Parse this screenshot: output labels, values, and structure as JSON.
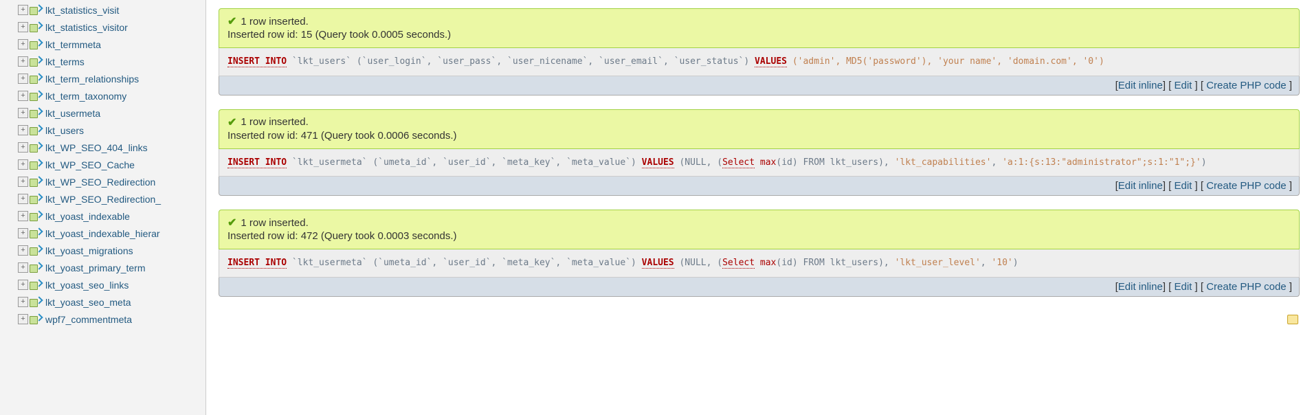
{
  "sidebar": {
    "tables": [
      "lkt_statistics_visit",
      "lkt_statistics_visitor",
      "lkt_termmeta",
      "lkt_terms",
      "lkt_term_relationships",
      "lkt_term_taxonomy",
      "lkt_usermeta",
      "lkt_users",
      "lkt_WP_SEO_404_links",
      "lkt_WP_SEO_Cache",
      "lkt_WP_SEO_Redirection",
      "lkt_WP_SEO_Redirection_",
      "lkt_yoast_indexable",
      "lkt_yoast_indexable_hierar",
      "lkt_yoast_migrations",
      "lkt_yoast_primary_term",
      "lkt_yoast_seo_links",
      "lkt_yoast_seo_meta",
      "wpf7_commentmeta"
    ]
  },
  "actions": {
    "edit_inline": "Edit inline",
    "edit": "Edit",
    "create_php": "Create PHP code"
  },
  "results": [
    {
      "inserted_msg": "1 row inserted.",
      "detail": "Inserted row id: 15 (Query took 0.0005 seconds.)",
      "sql": {
        "prefix": "INSERT INTO",
        "table": "`lkt_users`",
        "cols": "(`user_login`, `user_pass`, `user_nicename`, `user_email`, `user_status`)",
        "values_kw": "VALUES",
        "vals": "('admin', MD5('password'), 'your name', 'domain.com', '0')"
      }
    },
    {
      "inserted_msg": "1 row inserted.",
      "detail": "Inserted row id: 471 (Query took 0.0006 seconds.)",
      "sql": {
        "prefix": "INSERT INTO",
        "table": "`lkt_usermeta`",
        "cols": "(`umeta_id`, `user_id`, `meta_key`, `meta_value`)",
        "values_kw": "VALUES",
        "vals_pre": "(NULL, (",
        "select": "Select",
        "max": "max",
        "vals_mid": "(id) FROM lkt_users), ",
        "str1": "'lkt_capabilities'",
        "comma": ", ",
        "str2": "'a:1:{s:13:\"administrator\";s:1:\"1\";}'",
        "vals_post": ")"
      }
    },
    {
      "inserted_msg": "1 row inserted.",
      "detail": "Inserted row id: 472 (Query took 0.0003 seconds.)",
      "sql": {
        "prefix": "INSERT INTO",
        "table": "`lkt_usermeta`",
        "cols": "(`umeta_id`, `user_id`, `meta_key`, `meta_value`)",
        "values_kw": "VALUES",
        "vals_pre": "(NULL, (",
        "select": "Select",
        "max": "max",
        "vals_mid": "(id) FROM lkt_users), ",
        "str1": "'lkt_user_level'",
        "comma": ", ",
        "str2": "'10'",
        "vals_post": ")"
      }
    }
  ]
}
